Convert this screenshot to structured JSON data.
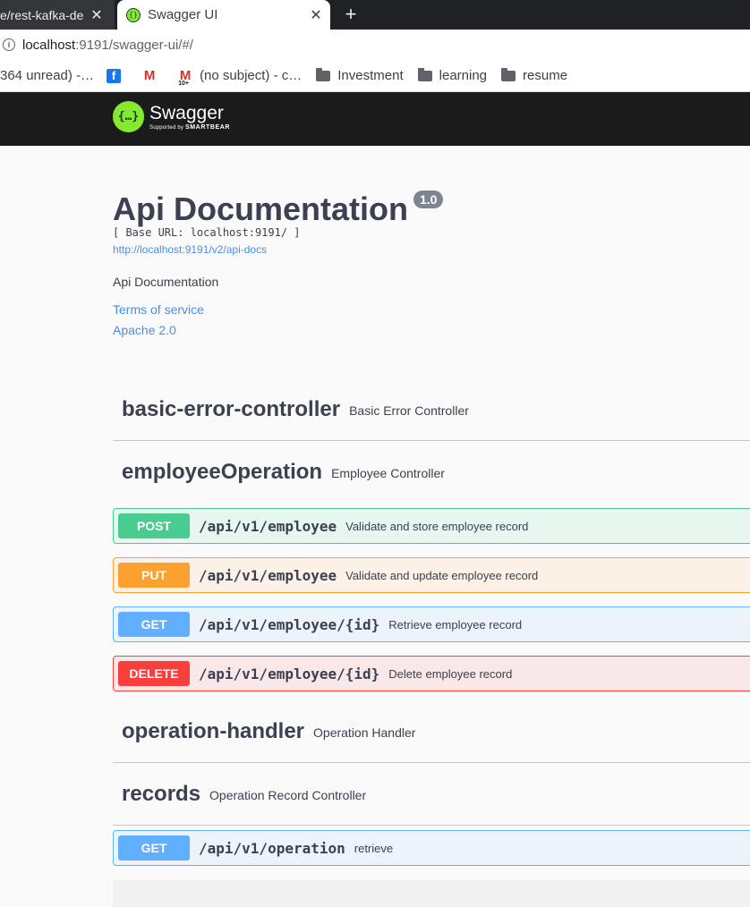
{
  "browser": {
    "tabs": [
      {
        "title": "e/rest-kafka-de"
      },
      {
        "title": "Swagger UI"
      }
    ],
    "url_host": "localhost",
    "url_rest": ":9191/swagger-ui/#/",
    "bookmarks": [
      {
        "label": "364 unread) -…",
        "icon": "mail-icon"
      },
      {
        "label": "",
        "icon": "facebook-icon"
      },
      {
        "label": "",
        "icon": "gmail-icon"
      },
      {
        "label": "(no subject) - c…",
        "icon": "gmail-count-icon",
        "badge": "10+"
      },
      {
        "label": "Investment",
        "icon": "folder-icon"
      },
      {
        "label": "learning",
        "icon": "folder-icon"
      },
      {
        "label": "resume",
        "icon": "folder-icon"
      }
    ]
  },
  "swagger": {
    "logo_name": "Swagger",
    "logo_sub_prefix": "Supported by",
    "logo_sub_brand": "SMARTBEAR"
  },
  "info": {
    "title": "Api Documentation",
    "version": "1.0",
    "base_url": "[ Base URL: localhost:9191/ ]",
    "docs_link": "http://localhost:9191/v2/api-docs",
    "description": "Api Documentation",
    "terms": "Terms of service",
    "license": "Apache 2.0"
  },
  "tags": [
    {
      "name": "basic-error-controller",
      "description": "Basic Error Controller"
    },
    {
      "name": "employeeOperation",
      "description": "Employee Controller"
    },
    {
      "name": "operation-handler",
      "description": "Operation Handler"
    },
    {
      "name": "records",
      "description": "Operation Record Controller"
    }
  ],
  "operations": [
    {
      "method": "POST",
      "path": "/api/v1/employee",
      "summary": "Validate and store employee record"
    },
    {
      "method": "PUT",
      "path": "/api/v1/employee",
      "summary": "Validate and update employee record"
    },
    {
      "method": "GET",
      "path": "/api/v1/employee/{id}",
      "summary": "Retrieve employee record"
    },
    {
      "method": "DELETE",
      "path": "/api/v1/employee/{id}",
      "summary": "Delete employee record"
    },
    {
      "method": "GET",
      "path": "/api/v1/operation",
      "summary": "retrieve"
    }
  ],
  "colors": {
    "post": "#49cc90",
    "put": "#fca130",
    "get": "#61affe",
    "delete": "#f93e3e",
    "swagger_green": "#85ea2d",
    "link": "#4990e2"
  }
}
